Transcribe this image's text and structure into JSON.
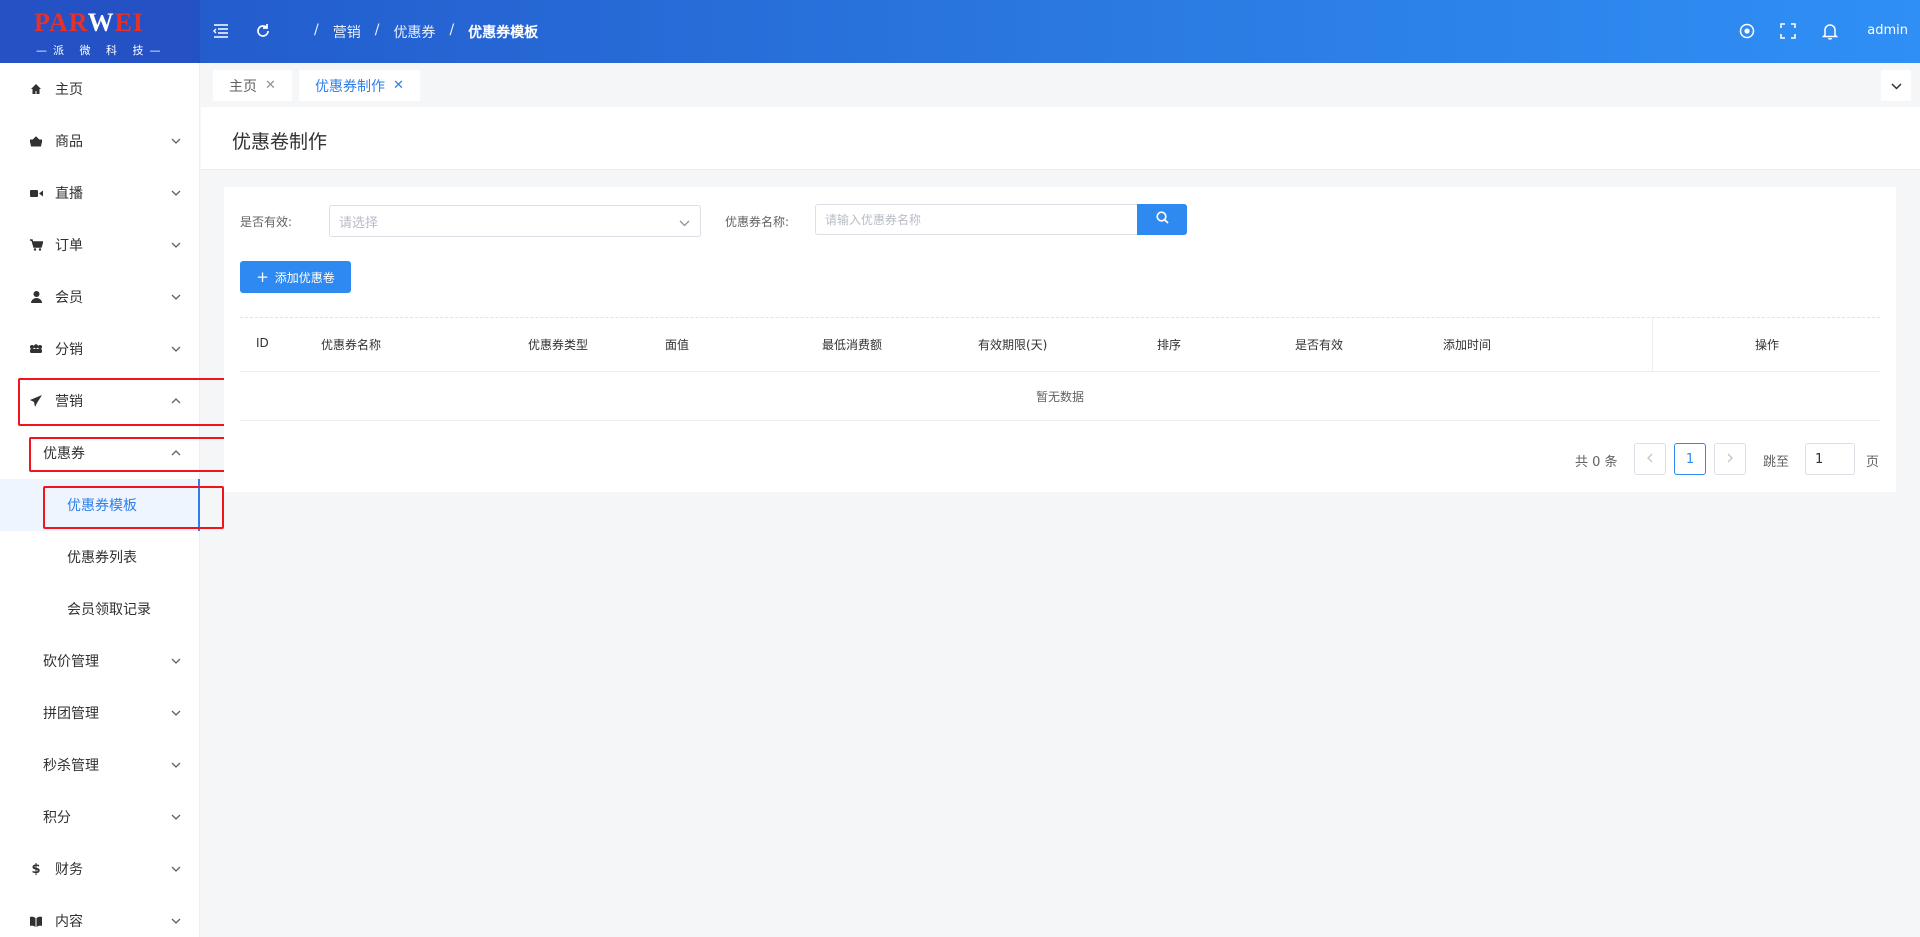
{
  "logo": {
    "brand_red": "PAR",
    "brand_white": "W",
    "brand_red2": "EI",
    "subtitle": "—派 微 科 技—"
  },
  "header": {
    "breadcrumb": [
      "营销",
      "优惠券",
      "优惠券模板"
    ],
    "breadcrumb_separator": "/",
    "user": "admin"
  },
  "sidebar": {
    "items": [
      {
        "label": "主页",
        "icon": "home-icon"
      },
      {
        "label": "商品",
        "icon": "basket-icon"
      },
      {
        "label": "直播",
        "icon": "video-icon"
      },
      {
        "label": "订单",
        "icon": "cart-icon"
      },
      {
        "label": "会员",
        "icon": "user-icon"
      },
      {
        "label": "分销",
        "icon": "group-icon"
      },
      {
        "label": "营销",
        "icon": "send-icon"
      },
      {
        "label": "优惠券"
      },
      {
        "label": "优惠券模板"
      },
      {
        "label": "优惠券列表"
      },
      {
        "label": "会员领取记录"
      },
      {
        "label": "砍价管理"
      },
      {
        "label": "拼团管理"
      },
      {
        "label": "秒杀管理"
      },
      {
        "label": "积分"
      },
      {
        "label": "财务",
        "icon": "dollar-icon"
      },
      {
        "label": "内容",
        "icon": "book-icon"
      }
    ]
  },
  "tabs": [
    {
      "label": "主页",
      "close": "✕"
    },
    {
      "label": "优惠券制作",
      "close": "✕"
    }
  ],
  "page": {
    "title": "优惠卷制作"
  },
  "filters": {
    "valid_label": "是否有效:",
    "valid_placeholder": "请选择",
    "name_label": "优惠券名称:",
    "name_placeholder": "请输入优惠券名称"
  },
  "actions": {
    "add_label": "添加优惠卷",
    "add_icon": "+"
  },
  "table": {
    "columns": [
      "ID",
      "优惠券名称",
      "优惠券类型",
      "面值",
      "最低消费额",
      "有效期限(天)",
      "排序",
      "是否有效",
      "添加时间",
      "操作"
    ],
    "empty_text": "暂无数据"
  },
  "pagination": {
    "total_text": "共 0 条",
    "current_page": "1",
    "goto_label": "跳至",
    "goto_value": "1",
    "page_suffix": "页"
  },
  "colors": {
    "primary": "#2e89f0",
    "header_start": "#2256c9",
    "header_end": "#2f8ff5",
    "highlight": "#f0141e"
  }
}
